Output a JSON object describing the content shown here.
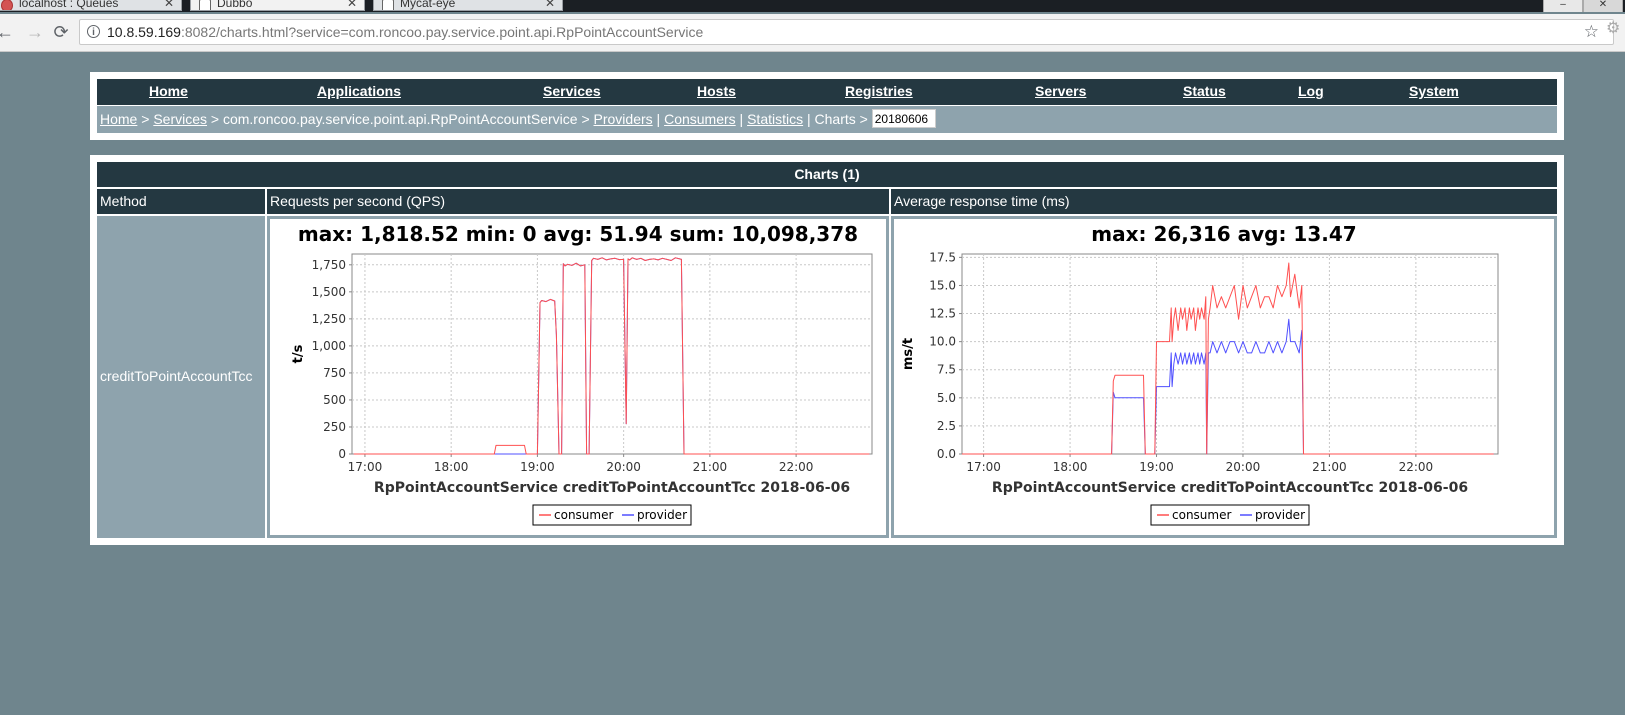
{
  "browser": {
    "tabs": [
      {
        "title": "localhost : Queues"
      },
      {
        "title": "Dubbo"
      },
      {
        "title": "Mycat-eye"
      }
    ],
    "url_host": "10.8.59.169",
    "url_rest": ":8082/charts.html?service=com.roncoo.pay.service.point.api.RpPointAccountService"
  },
  "menu": [
    "Home",
    "Applications",
    "Services",
    "Hosts",
    "Registries",
    "Servers",
    "Status",
    "Log",
    "System"
  ],
  "breadcrumb": {
    "home": "Home",
    "sep1": " > ",
    "services": "Services",
    "sep2": " > com.roncoo.pay.service.point.api.RpPointAccountService > ",
    "providers": "Providers",
    "sep3": " | ",
    "consumers": "Consumers",
    "sep4": " | ",
    "statistics": "Statistics",
    "sep5": " | Charts > ",
    "date": "20180606"
  },
  "table": {
    "title": "Charts (1)",
    "col_method": "Method",
    "col_qps": "Requests per second (QPS)",
    "col_art": "Average response time (ms)",
    "row_method": "creditToPointAccountTcc"
  },
  "chart_data": [
    {
      "type": "line",
      "title": "max: 1,818.52 min: 0 avg: 51.94 sum: 10,098,378",
      "xlabel": "RpPointAccountService  creditToPointAccountTcc  2018-06-06",
      "ylabel": "t/s",
      "xlim": [
        16.85,
        22.88
      ],
      "ylim": [
        0,
        1850
      ],
      "xticks": [
        17,
        18,
        19,
        20,
        21,
        22
      ],
      "xtick_labels": [
        "17:00",
        "18:00",
        "19:00",
        "20:00",
        "21:00",
        "22:00"
      ],
      "yticks": [
        0,
        250,
        500,
        750,
        1000,
        1250,
        1500,
        1750
      ],
      "ytick_labels": [
        "0",
        "250",
        "500",
        "750",
        "1,000",
        "1,250",
        "1,500",
        "1,750"
      ],
      "grid": true,
      "legend": "bottom-center",
      "colors": {
        "consumer": "#ff5050",
        "provider": "#5050ff"
      },
      "series": [
        {
          "name": "consumer",
          "x": [
            16.87,
            18.5,
            18.52,
            18.85,
            18.87,
            19.0,
            19.03,
            19.05,
            19.1,
            19.15,
            19.2,
            19.22,
            19.25,
            19.28,
            19.3,
            19.32,
            19.35,
            19.4,
            19.45,
            19.5,
            19.55,
            19.57,
            19.6,
            19.63,
            19.65,
            19.7,
            19.75,
            19.8,
            19.85,
            19.9,
            19.95,
            20.0,
            20.03,
            20.05,
            20.07,
            20.1,
            20.15,
            20.2,
            20.25,
            20.3,
            20.35,
            20.4,
            20.45,
            20.5,
            20.55,
            20.6,
            20.65,
            20.67,
            20.7,
            22.85
          ],
          "y": [
            0,
            0,
            80,
            80,
            0,
            0,
            1400,
            1420,
            1410,
            1430,
            1415,
            1100,
            0,
            0,
            1760,
            1740,
            1755,
            1745,
            1765,
            1740,
            1750,
            0,
            0,
            1790,
            1810,
            1800,
            1815,
            1795,
            1805,
            1810,
            1798,
            1800,
            280,
            1805,
            1795,
            1815,
            1800,
            1810,
            1790,
            1800,
            1805,
            1795,
            1810,
            1800,
            1790,
            1815,
            1805,
            1800,
            0,
            0
          ]
        },
        {
          "name": "provider",
          "x": [
            16.87,
            19.0,
            19.03,
            19.05,
            19.1,
            19.15,
            19.2,
            19.22,
            19.25,
            19.28,
            19.3,
            19.32,
            19.35,
            19.4,
            19.45,
            19.5,
            19.55,
            19.57,
            19.6,
            19.63,
            19.65,
            19.7,
            19.75,
            19.8,
            19.85,
            19.9,
            19.95,
            20.0,
            20.03,
            20.05,
            20.07,
            20.1,
            20.15,
            20.2,
            20.25,
            20.3,
            20.35,
            20.4,
            20.45,
            20.5,
            20.55,
            20.6,
            20.65,
            20.67,
            20.7,
            22.85
          ],
          "y": [
            0,
            0,
            1400,
            1420,
            1410,
            1430,
            1415,
            1100,
            0,
            0,
            1760,
            1740,
            1755,
            1745,
            1765,
            1740,
            1750,
            0,
            0,
            1790,
            1810,
            1800,
            1815,
            1795,
            1805,
            1810,
            1798,
            1800,
            280,
            1805,
            1795,
            1815,
            1800,
            1810,
            1790,
            1800,
            1805,
            1795,
            1810,
            1800,
            1790,
            1815,
            1805,
            1800,
            0,
            0
          ]
        }
      ]
    },
    {
      "type": "line",
      "title": "max: 26,316 avg: 13.47",
      "xlabel": "RpPointAccountService  creditToPointAccountTcc  2018-06-06",
      "ylabel": "ms/t",
      "xlim": [
        16.75,
        22.95
      ],
      "ylim": [
        0,
        17.8
      ],
      "xticks": [
        17,
        18,
        19,
        20,
        21,
        22
      ],
      "xtick_labels": [
        "17:00",
        "18:00",
        "19:00",
        "20:00",
        "21:00",
        "22:00"
      ],
      "yticks": [
        0,
        2.5,
        5,
        7.5,
        10,
        12.5,
        15,
        17.5
      ],
      "ytick_labels": [
        "0.0",
        "2.5",
        "5.0",
        "7.5",
        "10.0",
        "12.5",
        "15.0",
        "17.5"
      ],
      "grid": true,
      "legend": "bottom-center",
      "colors": {
        "consumer": "#ff5050",
        "provider": "#5050ff"
      },
      "series": [
        {
          "name": "consumer",
          "x": [
            16.75,
            18.48,
            18.5,
            18.52,
            18.85,
            18.87,
            18.98,
            19.0,
            19.02,
            19.15,
            19.17,
            19.18,
            19.2,
            19.22,
            19.25,
            19.28,
            19.3,
            19.33,
            19.35,
            19.38,
            19.4,
            19.43,
            19.45,
            19.48,
            19.5,
            19.52,
            19.55,
            19.57,
            19.58,
            19.6,
            19.62,
            19.65,
            19.7,
            19.75,
            19.8,
            19.85,
            19.9,
            19.95,
            20.0,
            20.05,
            20.1,
            20.15,
            20.2,
            20.25,
            20.3,
            20.35,
            20.4,
            20.45,
            20.5,
            20.53,
            20.55,
            20.6,
            20.65,
            20.68,
            20.7,
            22.9
          ],
          "y": [
            0,
            0,
            6.5,
            7,
            7,
            0,
            0,
            10,
            10,
            10,
            13,
            10,
            12,
            13,
            11,
            13,
            12,
            13,
            11,
            13,
            12,
            13,
            11,
            13,
            12,
            13,
            12,
            14,
            0,
            12,
            13,
            15,
            13,
            14,
            13,
            14,
            15,
            12,
            15,
            13,
            14,
            15,
            13,
            14,
            14,
            13,
            15,
            14,
            15,
            17,
            14,
            16,
            13,
            15,
            0,
            0
          ]
        },
        {
          "name": "provider",
          "x": [
            16.75,
            18.48,
            18.5,
            18.52,
            18.85,
            18.87,
            18.98,
            19.0,
            19.02,
            19.15,
            19.17,
            19.18,
            19.2,
            19.22,
            19.25,
            19.28,
            19.3,
            19.33,
            19.35,
            19.38,
            19.4,
            19.43,
            19.45,
            19.48,
            19.5,
            19.52,
            19.55,
            19.57,
            19.58,
            19.6,
            19.62,
            19.65,
            19.7,
            19.75,
            19.8,
            19.85,
            19.9,
            19.95,
            20.0,
            20.05,
            20.1,
            20.15,
            20.2,
            20.25,
            20.3,
            20.35,
            20.4,
            20.45,
            20.5,
            20.53,
            20.55,
            20.6,
            20.65,
            20.68,
            20.7,
            22.9
          ],
          "y": [
            0,
            0,
            5.5,
            5,
            5,
            0,
            0,
            6,
            6,
            6,
            9,
            6,
            8,
            9,
            8,
            9,
            8,
            9,
            8,
            9,
            8,
            9,
            8,
            9,
            8,
            9,
            8,
            9,
            0,
            9,
            9,
            10,
            9,
            10,
            9,
            10,
            10,
            9,
            10,
            9,
            9,
            10,
            9,
            9,
            10,
            9,
            10,
            9,
            10,
            12,
            10,
            10,
            9,
            11,
            0,
            0
          ]
        }
      ]
    }
  ]
}
